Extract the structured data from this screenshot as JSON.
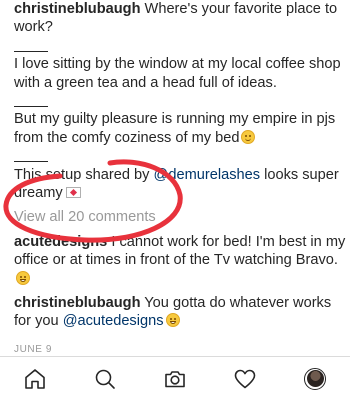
{
  "caption": {
    "username": "christineblubaugh",
    "text": "Where's your favorite place to work?",
    "paragraph1": "I love sitting by the window at my local coffee shop with a green tea and a head full of ideas.",
    "paragraph2": "But my guilty pleasure is running my empire in pjs from the comfy coziness of my bed",
    "paragraph3_before": "This setup shared by",
    "paragraph3_mention": "@demurelashes",
    "paragraph3_after": "looks super dreamy"
  },
  "view_all_comments": "View all 20 comments",
  "comments": [
    {
      "username": "acutedesigns",
      "text": "I cannot work for bed! I'm best in my office or at times in front of the Tv watching Bravo."
    },
    {
      "username": "christineblubaugh",
      "text": "You gotta do whatever works for you",
      "mention": "@acutedesigns"
    }
  ],
  "post_date": "JUNE 9",
  "annotation": {
    "color": "#e8323c",
    "shape": "hand-drawn-ellipse"
  },
  "colors": {
    "text": "#262626",
    "muted": "#999999",
    "mention": "#003569"
  },
  "tabbar": {
    "items": [
      {
        "name": "home-icon"
      },
      {
        "name": "search-icon"
      },
      {
        "name": "camera-icon"
      },
      {
        "name": "heart-icon"
      },
      {
        "name": "profile-avatar"
      }
    ]
  }
}
